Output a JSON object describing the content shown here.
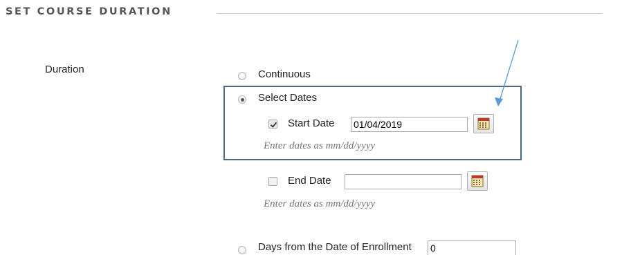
{
  "section": {
    "title": "SET COURSE DURATION"
  },
  "duration": {
    "label": "Duration",
    "options": {
      "continuous": {
        "label": "Continuous",
        "selected": false
      },
      "select_dates": {
        "label": "Select Dates",
        "selected": true
      },
      "days_from_enrollment": {
        "label": "Days from the Date of Enrollment",
        "selected": false,
        "value": "0"
      }
    },
    "start_date": {
      "label": "Start Date",
      "checked": true,
      "value": "01/04/2019",
      "hint": "Enter dates as mm/dd/yyyy"
    },
    "end_date": {
      "label": "End Date",
      "checked": false,
      "value": "",
      "hint": "Enter dates as mm/dd/yyyy"
    }
  },
  "icons": {
    "calendar": "calendar-icon",
    "annotation_arrow": "arrow-icon"
  },
  "colors": {
    "highlight_border": "#4a6783",
    "arrow": "#5b9bd5",
    "heading": "#555555",
    "hint": "#777777"
  }
}
